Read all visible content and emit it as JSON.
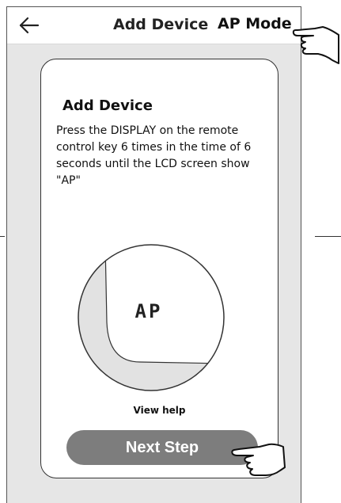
{
  "header": {
    "title": "Add Device",
    "mode_label": "AP Mode",
    "back_icon": "back-arrow-icon"
  },
  "card": {
    "title": "Add Device",
    "description": "Press the DISPLAY on the remote control key 6 times in the time of 6 seconds until the LCD screen show \"AP\"",
    "lcd_text": "AP",
    "view_help_label": "View help",
    "next_button_label": "Next Step"
  },
  "colors": {
    "background": "#e6e6e6",
    "card": "#ffffff",
    "button": "#7d7d7d",
    "button_text": "#ffffff"
  },
  "icons": {
    "pointer_top": "pointing-hand-icon",
    "pointer_bottom": "pointing-hand-icon"
  }
}
